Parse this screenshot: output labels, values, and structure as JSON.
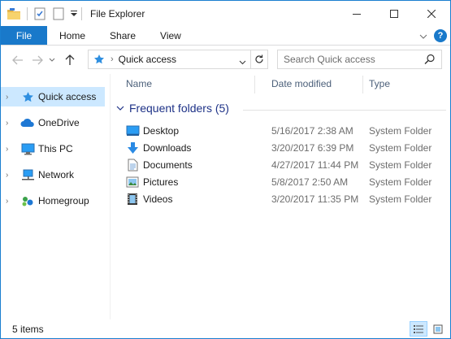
{
  "window": {
    "title": "File Explorer"
  },
  "ribbon": {
    "file": "File",
    "tabs": [
      "Home",
      "Share",
      "View"
    ],
    "help": "?"
  },
  "nav": {
    "address": "Quick access",
    "search_placeholder": "Search Quick access"
  },
  "sidebar": {
    "items": [
      {
        "label": "Quick access",
        "icon": "star-icon",
        "selected": true
      },
      {
        "label": "OneDrive",
        "icon": "cloud-icon",
        "selected": false
      },
      {
        "label": "This PC",
        "icon": "computer-icon",
        "selected": false
      },
      {
        "label": "Network",
        "icon": "network-icon",
        "selected": false
      },
      {
        "label": "Homegroup",
        "icon": "homegroup-icon",
        "selected": false
      }
    ]
  },
  "columns": {
    "name": "Name",
    "date": "Date modified",
    "type": "Type"
  },
  "group": {
    "label": "Frequent folders (5)"
  },
  "files": [
    {
      "name": "Desktop",
      "date": "5/16/2017 2:38 AM",
      "type": "System Folder",
      "icon": "desktop-icon"
    },
    {
      "name": "Downloads",
      "date": "3/20/2017 6:39 PM",
      "type": "System Folder",
      "icon": "downloads-icon"
    },
    {
      "name": "Documents",
      "date": "4/27/2017 11:44 PM",
      "type": "System Folder",
      "icon": "documents-icon"
    },
    {
      "name": "Pictures",
      "date": "5/8/2017 2:50 AM",
      "type": "System Folder",
      "icon": "pictures-icon"
    },
    {
      "name": "Videos",
      "date": "3/20/2017 11:35 PM",
      "type": "System Folder",
      "icon": "videos-icon"
    }
  ],
  "status": {
    "items": "5 items"
  },
  "colors": {
    "accent": "#1979ca",
    "selection": "#cce8ff",
    "group": "#1e3287"
  }
}
